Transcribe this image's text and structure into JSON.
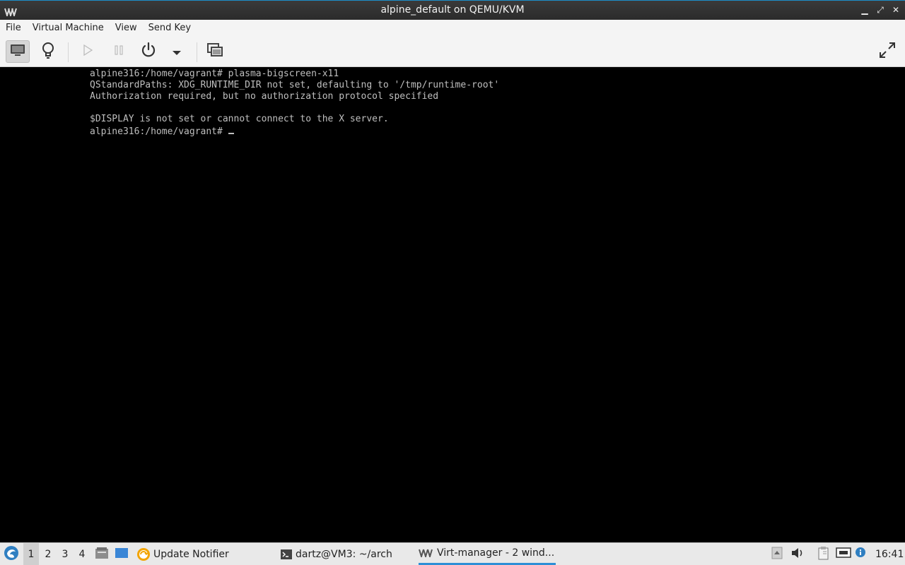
{
  "window": {
    "title": "alpine_default on QEMU/KVM",
    "controls": {
      "minimize": "▁",
      "maximize": "⤢",
      "close": "✕"
    }
  },
  "menu": {
    "items": [
      "File",
      "Virtual Machine",
      "View",
      "Send Key"
    ]
  },
  "toolbar": {
    "buttons": [
      {
        "icon": "monitor-icon",
        "active": true
      },
      {
        "icon": "lightbulb-icon",
        "active": false
      },
      {
        "icon": "play-icon",
        "active": false
      },
      {
        "icon": "pause-icon",
        "active": false
      },
      {
        "icon": "power-icon",
        "active": false
      },
      {
        "icon": "dropdown-arrow-icon",
        "active": false
      },
      {
        "icon": "screenshot-windows-icon",
        "active": false
      },
      {
        "icon": "fullscreen-icon",
        "active": false
      }
    ]
  },
  "console": {
    "lines": [
      "alpine316:/home/vagrant# plasma-bigscreen-x11",
      "QStandardPaths: XDG_RUNTIME_DIR not set, defaulting to '/tmp/runtime-root'",
      "Authorization required, but no authorization protocol specified",
      "",
      "$DISPLAY is not set or cannot connect to the X server.",
      "alpine316:/home/vagrant# "
    ]
  },
  "taskbar": {
    "workspaces": [
      "1",
      "2",
      "3",
      "4"
    ],
    "current_workspace": "1",
    "tasks": [
      {
        "label": "Update Notifier",
        "icon": "update-notifier-icon"
      },
      {
        "label": "dartz@VM3: ~/arch",
        "icon": "terminal-icon"
      },
      {
        "label": "Virt-manager - 2 wind...",
        "icon": "virt-manager-icon",
        "active": true
      }
    ],
    "clock": "16:41",
    "accent": "#2d8fd6"
  }
}
